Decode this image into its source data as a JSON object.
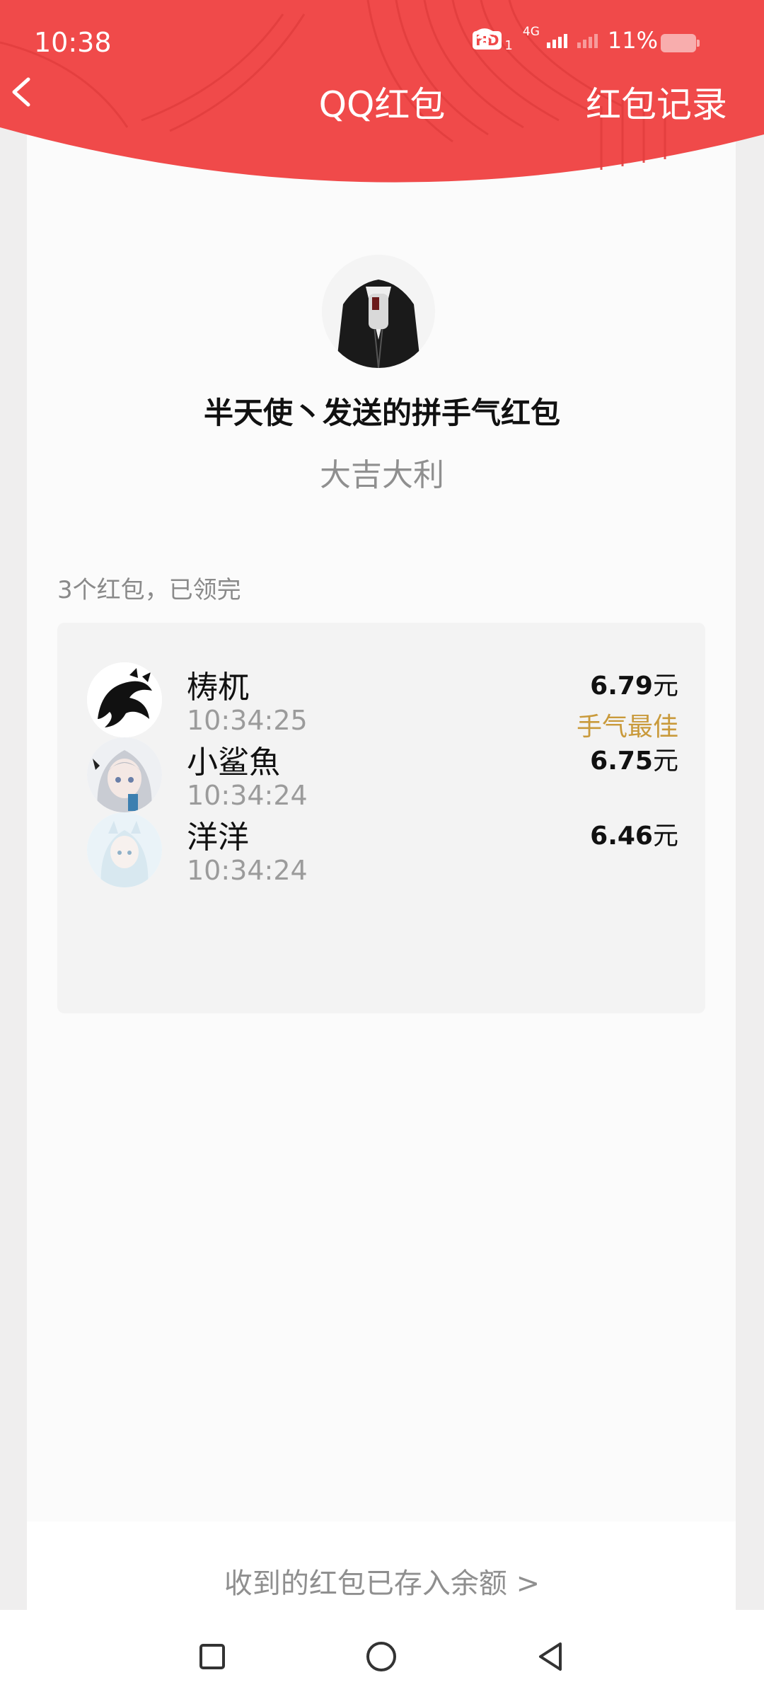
{
  "status_bar": {
    "time": "10:38",
    "hd": "HD",
    "hd_sub": "1",
    "network": "4G",
    "battery": "11%"
  },
  "nav": {
    "title": "QQ红包",
    "record_link": "红包记录",
    "back_icon": "chevron-left-icon"
  },
  "colors": {
    "header_red": "#f04a4a",
    "best_luck": "#c99a3b"
  },
  "packet": {
    "sender_title": "半天使丶发送的拼手气红包",
    "greeting": "大吉大利",
    "summary": "3个红包，已领完"
  },
  "receivers": [
    {
      "name": "梼杌",
      "time": "10:34:25",
      "amount": "6.79",
      "unit": "元",
      "tag": "手气最佳"
    },
    {
      "name": "小鲨魚",
      "time": "10:34:24",
      "amount": "6.75",
      "unit": "元",
      "tag": ""
    },
    {
      "name": "洋洋",
      "time": "10:34:24",
      "amount": "6.46",
      "unit": "元",
      "tag": ""
    }
  ],
  "footer": {
    "deposit_text": "收到的红包已存入余额 >"
  },
  "system_nav": [
    "recents-square-icon",
    "home-circle-icon",
    "back-triangle-icon"
  ]
}
